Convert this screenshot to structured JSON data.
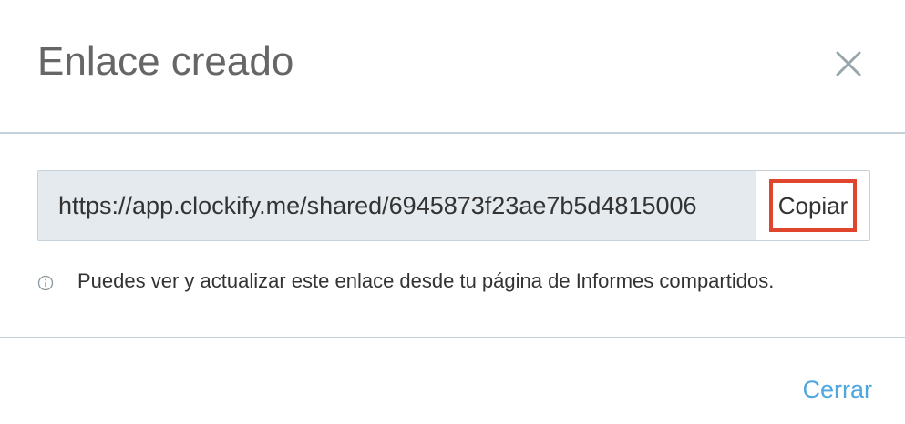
{
  "dialog": {
    "title": "Enlace creado",
    "close_icon": "close-icon",
    "link": {
      "value": "https://app.clockify.me/shared/6945873f23ae7b5d4815006",
      "copy_label": "Copiar"
    },
    "info": {
      "icon": "info-circle-icon",
      "text": "Puedes ver y actualizar este enlace desde tu página de Informes compartidos."
    },
    "footer": {
      "close_label": "Cerrar"
    }
  },
  "colors": {
    "title": "#666666",
    "divider": "#c6d2d9",
    "input_bg": "#e4eaee",
    "highlight": "#e0452d",
    "link": "#4fa7e0"
  }
}
